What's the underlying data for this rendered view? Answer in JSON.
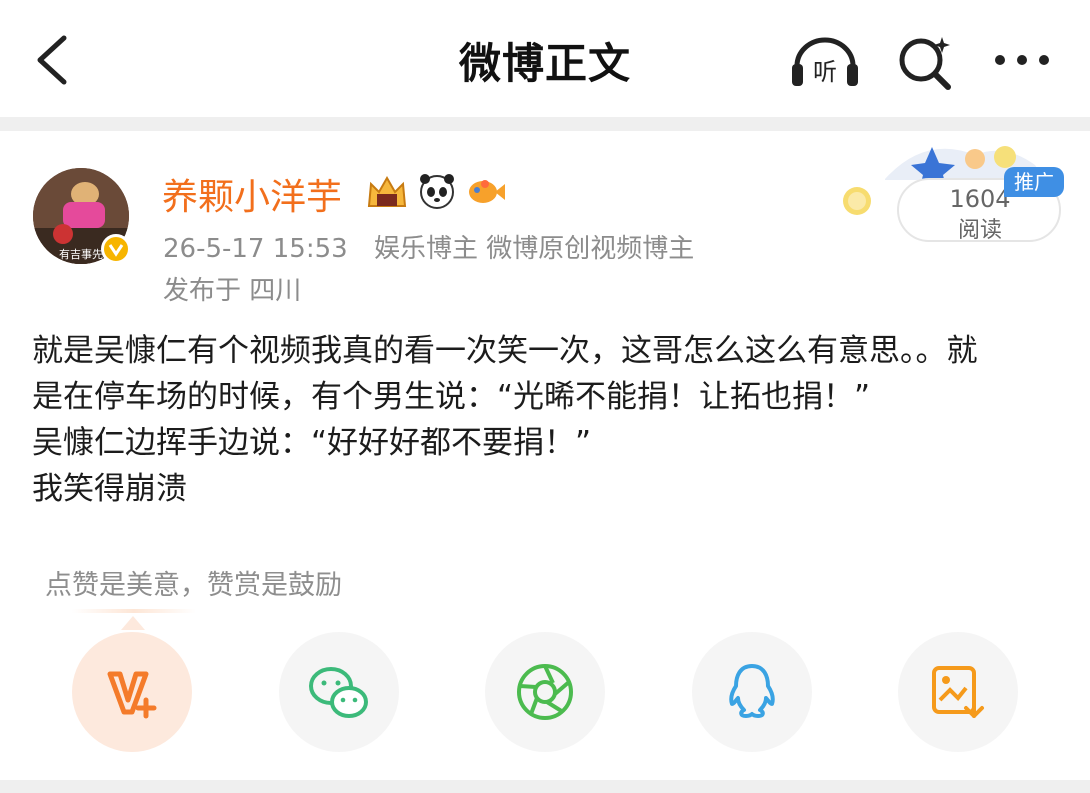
{
  "header": {
    "title": "微博正文",
    "listen_label": "听",
    "icons": [
      "back-arrow-icon",
      "headphones-listen-icon",
      "search-icon",
      "more-icon"
    ]
  },
  "post": {
    "username": "养颗小洋芋",
    "timestamp": "26-5-17 15:53",
    "user_tags": "娱乐博主 微博原创视频博主",
    "location": "发布于 四川",
    "avatar_caption": "有吉事先",
    "read_count": "1604",
    "read_label": "阅读",
    "promo_tag": "推广",
    "body_lines": [
      "就是吴慷仁有个视频我真的看一次笑一次，这哥怎么这么有意思。。就",
      "是在停车场的时候，有个男生说：“光晞不能捐！让拓也捐！”",
      "吴慷仁边挥手边说：“好好好都不要捐！”",
      "我笑得崩溃"
    ]
  },
  "reward": {
    "text": "点赞是美意，赞赏是鼓励"
  },
  "share": [
    {
      "name": "reward",
      "icon": "reward-v-plus-icon",
      "color": "#f47b2a"
    },
    {
      "name": "wechat",
      "icon": "wechat-icon",
      "color": "#3cba7a"
    },
    {
      "name": "moments",
      "icon": "moments-aperture-icon",
      "color": "#4cbb4f"
    },
    {
      "name": "qq",
      "icon": "qq-icon",
      "color": "#3aa3e3"
    },
    {
      "name": "save-image",
      "icon": "save-image-icon",
      "color": "#f59a1b"
    }
  ],
  "colors": {
    "accent": "#f26f1c",
    "meta_gray": "#8c8c8c",
    "tag_blue": "#3f8fe4"
  }
}
